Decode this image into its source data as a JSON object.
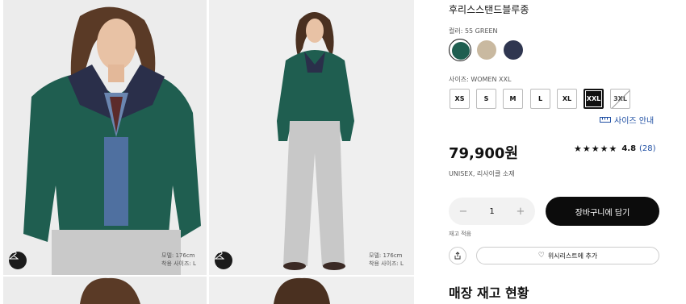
{
  "product": {
    "name": "후리스스탠드블루종",
    "color_label": "컬러: 55 GREEN",
    "swatches": [
      {
        "name": "green",
        "color": "#1f5e50",
        "selected": true
      },
      {
        "name": "beige",
        "color": "#c9b9a0",
        "selected": false
      },
      {
        "name": "navy",
        "color": "#2f3650",
        "selected": false
      }
    ],
    "size_label": "사이즈: WOMEN XXL",
    "sizes": [
      {
        "label": "XS",
        "state": "normal"
      },
      {
        "label": "S",
        "state": "normal"
      },
      {
        "label": "M",
        "state": "normal"
      },
      {
        "label": "L",
        "state": "normal"
      },
      {
        "label": "XL",
        "state": "normal"
      },
      {
        "label": "XXL",
        "state": "selected"
      },
      {
        "label": "3XL",
        "state": "disabled"
      }
    ],
    "size_guide": "사이즈 안내",
    "price": "79,900원",
    "rating": {
      "stars": "★★★★★",
      "score": "4.8",
      "count": "(28)",
      "value": 4.8
    },
    "material": "UNISEX, 리사이클 소재",
    "quantity": {
      "minus": "−",
      "value": "1",
      "plus": "+"
    },
    "cart_button": "장바구니에 담기",
    "stock_note": "재고 적음",
    "wishlist_button": "위시리스트에 추가",
    "store_stock_title": "매장 재고 현황"
  },
  "gallery": {
    "photo1_model": {
      "line1": "모델: 176cm",
      "line2": "착용 사이즈: L"
    },
    "photo2_model": {
      "line1": "모델: 176cm",
      "line2": "착용 사이즈: L"
    }
  },
  "colors": {
    "jacket_green": "#1f5e50",
    "accent_blue": "#1f4fa3",
    "button_black": "#0c0c0c"
  }
}
